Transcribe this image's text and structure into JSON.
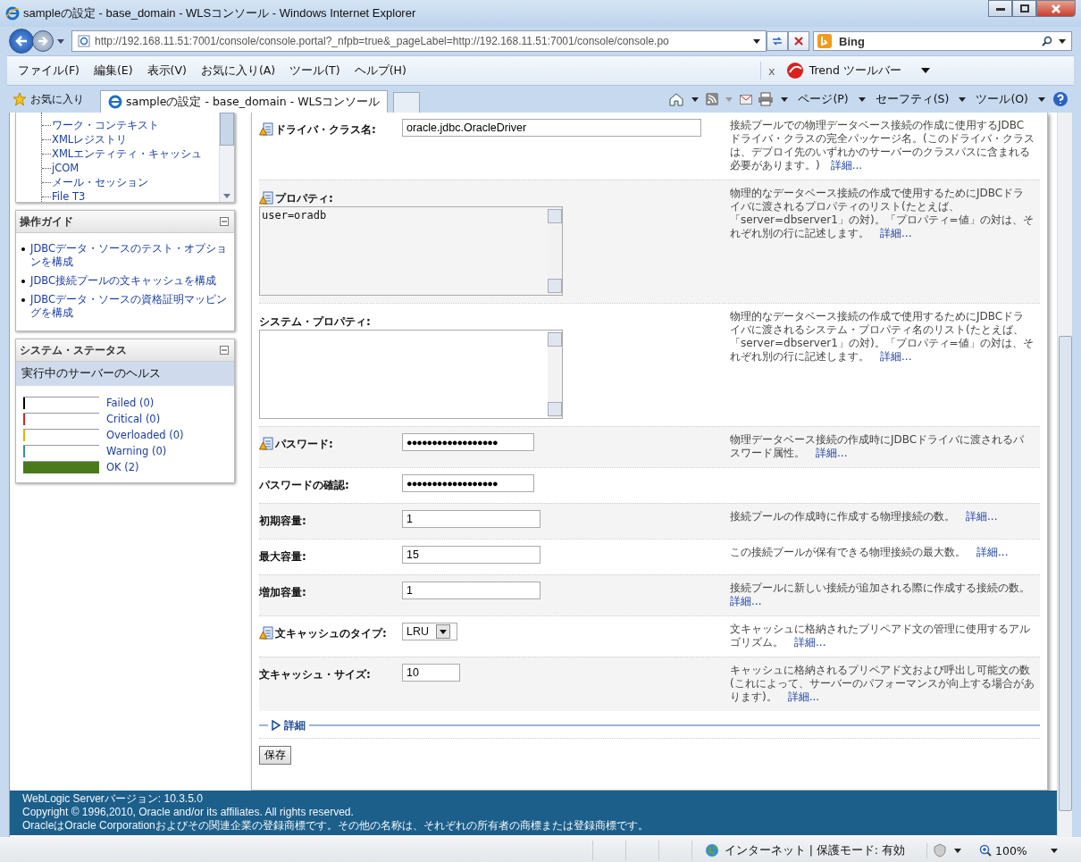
{
  "window": {
    "title": "sampleの設定 - base_domain - WLSコンソール - Windows Internet Explorer"
  },
  "address_bar": {
    "url": "http://192.168.11.51:7001/console/console.portal?_nfpb=true&_pageLabel=http://192.168.11.51:7001/console/console.po"
  },
  "search": {
    "placeholder": "Bing"
  },
  "menu": [
    "ファイル(F)",
    "編集(E)",
    "表示(V)",
    "お気に入り(A)",
    "ツール(T)",
    "ヘルプ(H)"
  ],
  "toolbar_addon": {
    "close": "x",
    "label": "Trend ツールバー"
  },
  "favorites": {
    "label": "お気に入り"
  },
  "tabs": [
    {
      "label": "sampleの設定 - base_domain - WLSコンソール",
      "selected": true
    }
  ],
  "command_bar": [
    "ページ(P)",
    "セーフティ(S)",
    "ツール(O)"
  ],
  "sidebar": {
    "tree": {
      "items": [
        "ワーク・コンテキスト",
        "XMLレジストリ",
        "XMLエンティティ・キャッシュ",
        "jCOM",
        "メール・セッション",
        "File T3"
      ]
    },
    "guide": {
      "title": "操作ガイド",
      "links": [
        "JDBCデータ・ソースのテスト・オプションを構成",
        "JDBC接続プールの文キャッシュを構成",
        "JDBCデータ・ソースの資格証明マッピングを構成"
      ]
    },
    "status": {
      "title": "システム・ステータス",
      "subtitle": "実行中のサーバーのヘルス",
      "health": [
        {
          "label": "Failed (0)",
          "color": "#000000",
          "level": 0
        },
        {
          "label": "Critical (0)",
          "color": "#e02020",
          "level": 0
        },
        {
          "label": "Overloaded (0)",
          "color": "#f0b000",
          "level": 0
        },
        {
          "label": "Warning (0)",
          "color": "#3090b0",
          "level": 0
        },
        {
          "label": "OK (2)",
          "color": "#4a7a1c",
          "level": 1
        }
      ]
    }
  },
  "form": {
    "rows": [
      {
        "label": "ドライバ・クラス名:",
        "restart_icon": true,
        "field": {
          "kind": "text_long",
          "value": "oracle.jdbc.OracleDriver"
        },
        "description": "接続プールでの物理データベース接続の作成に使用するJDBCドライバ・クラスの完全パッケージ名。(このドライバ・クラスは、デプロイ先のいずれかのサーバーのクラスパスに含まれる必要があります。)",
        "more": "詳細..."
      },
      {
        "label": "プロパティ:",
        "restart_icon": true,
        "field": {
          "kind": "textarea",
          "value": "user=oradb"
        },
        "description": "物理的なデータベース接続の作成で使用するためにJDBCドライバに渡されるプロパティのリスト(たとえば、「server=dbserver1」の対)。「プロパティ=値」の対は、それぞれ別の行に記述します。",
        "more": "詳細..."
      },
      {
        "label": "システム・プロパティ:",
        "restart_icon": false,
        "field": {
          "kind": "textarea"
        },
        "description": "物理的なデータベース接続の作成で使用するためにJDBCドライバに渡されるシステム・プロパティ名のリスト(たとえば、「server=dbserver1」の対)。「プロパティ=値」の対は、それぞれ別の行に記述します。",
        "more": "詳細..."
      },
      {
        "label": "パスワード:",
        "restart_icon": true,
        "field": {
          "kind": "password",
          "value": "●●●●●●●●●●●●●●●●●●"
        },
        "description": "物理データベース接続の作成時にJDBCドライバに渡されるパスワード属性。",
        "more": "詳細..."
      },
      {
        "label": "パスワードの確認:",
        "restart_icon": false,
        "field": {
          "kind": "password",
          "value": "●●●●●●●●●●●●●●●●●●"
        }
      },
      {
        "label": "初期容量:",
        "restart_icon": false,
        "field": {
          "kind": "text",
          "value": "1"
        },
        "description": "接続プールの作成時に作成する物理接続の数。",
        "more": "詳細..."
      },
      {
        "label": "最大容量:",
        "restart_icon": false,
        "field": {
          "kind": "text",
          "value": "15"
        },
        "description": "この接続プールが保有できる物理接続の最大数。",
        "more": "詳細..."
      },
      {
        "label": "増加容量:",
        "restart_icon": false,
        "field": {
          "kind": "text",
          "value": "1"
        },
        "description": "接続プールに新しい接続が追加される際に作成する接続の数。",
        "more": "詳細..."
      },
      {
        "label": "文キャッシュのタイプ:",
        "restart_icon": true,
        "field": {
          "kind": "select",
          "value": "LRU"
        },
        "description": "文キャッシュに格納されたプリペアド文の管理に使用するアルゴリズム。",
        "more": "詳細..."
      },
      {
        "label": "文キャッシュ・サイズ:",
        "restart_icon": false,
        "field": {
          "kind": "text_short",
          "value": "10"
        },
        "description": "キャッシュに格納されるプリペアド文および呼出し可能文の数(これによって、サーバーのパフォーマンスが向上する場合があります)。",
        "more": "詳細..."
      }
    ],
    "details_toggle": {
      "label": "詳細",
      "expanded": false
    },
    "save_button": "保存"
  },
  "footer": [
    "WebLogic Serverバージョン: 10.3.5.0",
    "Copyright © 1996,2010, Oracle and/or its affiliates. All rights reserved.",
    "OracleはOracle Corporationおよびその関連企業の登録商標です。その他の名称は、それぞれの所有者の商標または登録商標です。"
  ],
  "status_bar": {
    "zone": "インターネット | 保護モード: 有効",
    "zoom": "100%"
  }
}
